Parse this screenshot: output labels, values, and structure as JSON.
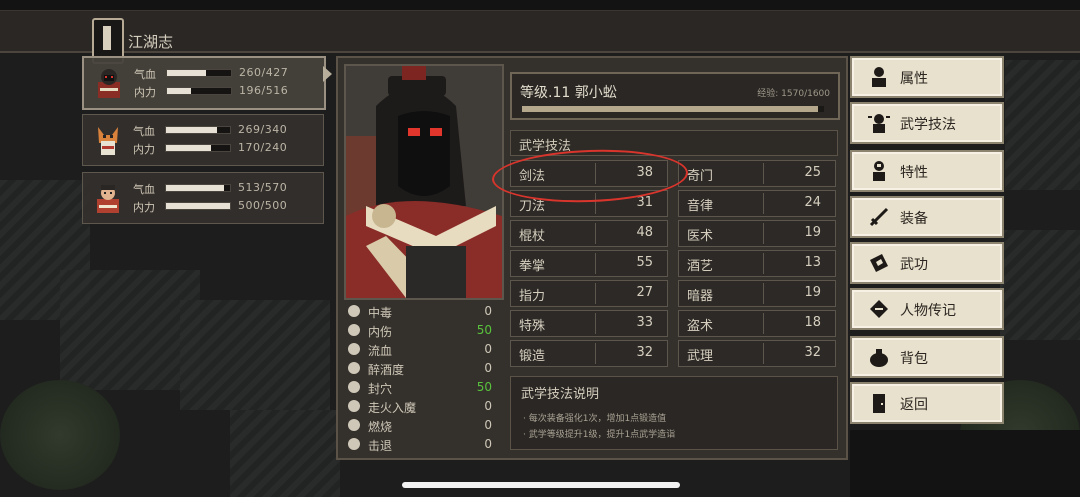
{
  "top_bar": {
    "title": "江湖志"
  },
  "party": [
    {
      "hp_label": "气血",
      "hp_value": "260/427",
      "hp_ratio": 0.61,
      "mp_label": "内力",
      "mp_value": "196/516",
      "mp_ratio": 0.38
    },
    {
      "hp_label": "气血",
      "hp_value": "269/340",
      "hp_ratio": 0.79,
      "mp_label": "内力",
      "mp_value": "170/240",
      "mp_ratio": 0.71
    },
    {
      "hp_label": "气血",
      "hp_value": "513/570",
      "hp_ratio": 0.9,
      "mp_label": "内力",
      "mp_value": "500/500",
      "mp_ratio": 1.0
    }
  ],
  "character": {
    "level_text": "等级.11 郭小蚣",
    "exp_text": "经验: 1570/1600",
    "exp_ratio": 0.98
  },
  "status_effects": [
    {
      "name": "中毒",
      "value": "0",
      "color": "#cfc8b8",
      "icon": "poison-icon"
    },
    {
      "name": "内伤",
      "value": "50",
      "color": "#58c23c",
      "icon": "broken-heart-icon"
    },
    {
      "name": "流血",
      "value": "0",
      "color": "#cfc8b8",
      "icon": "blood-icon"
    },
    {
      "name": "醉酒度",
      "value": "0",
      "color": "#cfc8b8",
      "icon": "drunk-icon"
    },
    {
      "name": "封穴",
      "value": "50",
      "color": "#58c23c",
      "icon": "acupoint-icon"
    },
    {
      "name": "走火入魔",
      "value": "0",
      "color": "#cfc8b8",
      "icon": "demon-icon"
    },
    {
      "name": "燃烧",
      "value": "0",
      "color": "#cfc8b8",
      "icon": "fire-icon"
    },
    {
      "name": "击退",
      "value": "0",
      "color": "#cfc8b8",
      "icon": "knockback-icon"
    }
  ],
  "skills_section": {
    "title": "武学技法"
  },
  "skills_left": [
    {
      "name": "剑法",
      "value": "38"
    },
    {
      "name": "刀法",
      "value": "31"
    },
    {
      "name": "棍杖",
      "value": "48"
    },
    {
      "name": "拳掌",
      "value": "55"
    },
    {
      "name": "指力",
      "value": "27"
    },
    {
      "name": "特殊",
      "value": "33"
    },
    {
      "name": "锻造",
      "value": "32"
    }
  ],
  "skills_right": [
    {
      "name": "奇门",
      "value": "25"
    },
    {
      "name": "音律",
      "value": "24"
    },
    {
      "name": "医术",
      "value": "19"
    },
    {
      "name": "酒艺",
      "value": "13"
    },
    {
      "name": "暗器",
      "value": "19"
    },
    {
      "name": "盗术",
      "value": "18"
    },
    {
      "name": "武理",
      "value": "32"
    }
  ],
  "description": {
    "title": "武学技法说明",
    "line1": "· 每次装备强化1次，增加1点锻造值",
    "line2": "· 武学等级提升1级，提升1点武学造诣"
  },
  "menu": [
    {
      "label": "属性",
      "icon": "person-icon"
    },
    {
      "label": "武学技法",
      "icon": "martial-arts-icon"
    },
    {
      "label": "特性",
      "icon": "trait-icon"
    },
    {
      "label": "装备",
      "icon": "sword-icon"
    },
    {
      "label": "武功",
      "icon": "manual-book-icon"
    },
    {
      "label": "人物传记",
      "icon": "biography-icon"
    },
    {
      "label": "背包",
      "icon": "bag-icon"
    },
    {
      "label": "返回",
      "icon": "door-icon"
    }
  ],
  "colors": {
    "highlight_circle": "#d9352c",
    "positive_value": "#58c23c"
  }
}
